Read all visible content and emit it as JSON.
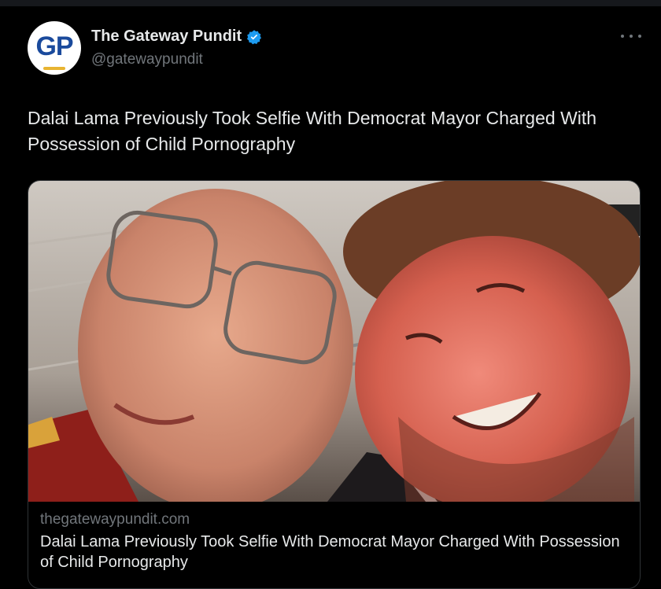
{
  "author": {
    "display_name": "The Gateway Pundit",
    "handle": "@gatewaypundit",
    "avatar_text": "GP",
    "verified": true
  },
  "tweet": {
    "text": "Dalai Lama Previously Took Selfie With Democrat Mayor Charged With Possession of Child Pornography"
  },
  "card": {
    "domain": "thegatewaypundit.com",
    "title": "Dalai Lama Previously Took Selfie With Democrat Mayor Charged With Possession of Child Pornography",
    "image_description": "selfie-photo"
  },
  "icons": {
    "verified": "verified-badge-icon",
    "more": "more-options-icon"
  },
  "colors": {
    "background": "#000000",
    "text_primary": "#e7e9ea",
    "text_secondary": "#71767b",
    "verified_blue": "#1d9bf0",
    "card_border": "#2f3336",
    "avatar_blue": "#1a4a9c"
  }
}
